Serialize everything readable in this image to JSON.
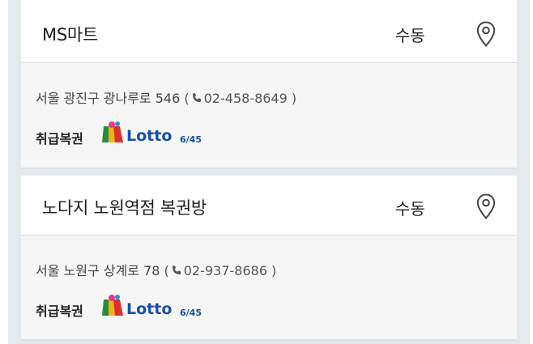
{
  "stores": [
    {
      "name": "MS마트",
      "method": "수동",
      "address": "서울 광진구 광나루로 546",
      "phone": "02-458-8649",
      "sale_label": "취급복권",
      "lotto_logo": {
        "word": "Lotto",
        "suffix": "6/45"
      }
    },
    {
      "name": "노다지 노원역점 복권방",
      "method": "수동",
      "address": "서울 노원구 상계로 78",
      "phone": "02-937-8686",
      "sale_label": "취급복권",
      "lotto_logo": {
        "word": "Lotto",
        "suffix": "6/45"
      }
    }
  ],
  "icons": {
    "location": "location-pin-icon",
    "phone": "phone-icon",
    "logo": "lotto-logo"
  },
  "colors": {
    "background": "#e6e9ec",
    "card_header": "#ffffff",
    "card_body": "#f6f6f7",
    "lotto_blue": "#1a4fa0"
  }
}
